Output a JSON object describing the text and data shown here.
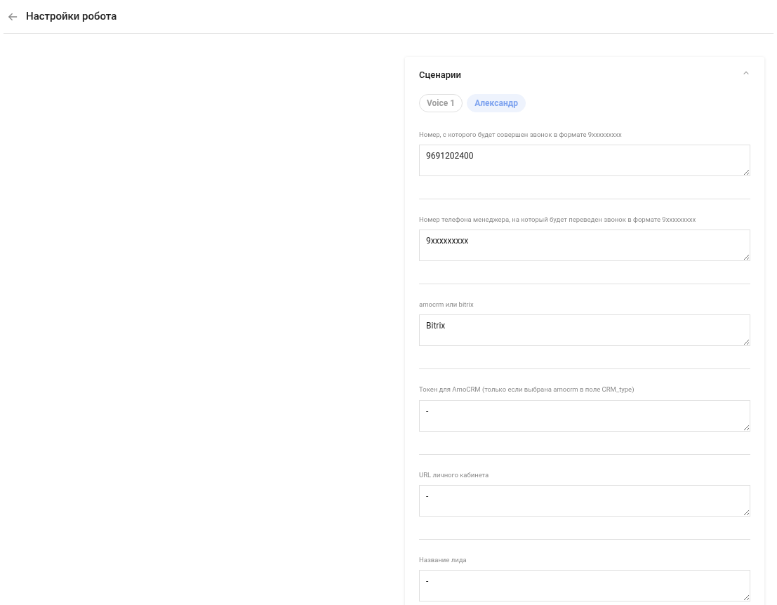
{
  "header": {
    "title": "Настройки робота"
  },
  "card": {
    "title": "Сценарии",
    "expanded": true,
    "scenarios": [
      {
        "label": "Voice 1",
        "selected": false
      },
      {
        "label": "Александр",
        "selected": true
      }
    ],
    "fields": [
      {
        "label": "Номер, с которого будет совершен звонок в формате 9xxxxxxxxx",
        "value": "9691202400"
      },
      {
        "label": "Номер телефона менеджера, на который будет переведен звонок в формате 9xxxxxxxxx",
        "value": "9xxxxxxxxx"
      },
      {
        "label": "amocrm или bitrix",
        "value": "Bitrix"
      },
      {
        "label": "Токен для AmoCRM (только если выбрана amocrm в поле CRM_type)",
        "value": "-"
      },
      {
        "label": "URL личного кабинета",
        "value": "-"
      },
      {
        "label": "Название лида",
        "value": "-"
      }
    ]
  }
}
